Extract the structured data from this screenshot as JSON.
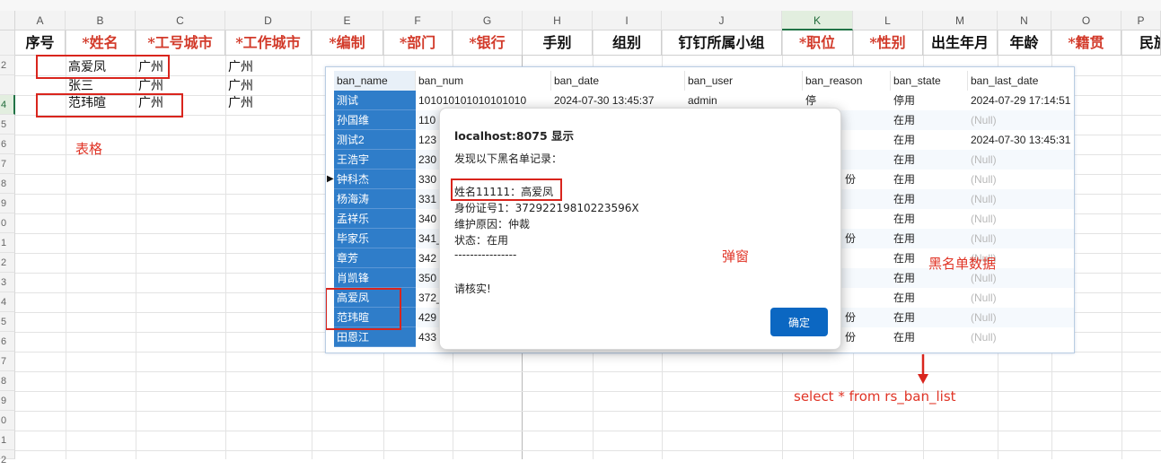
{
  "columns": [
    "A",
    "B",
    "C",
    "D",
    "E",
    "F",
    "G",
    "H",
    "I",
    "J",
    "K",
    "L",
    "M",
    "N",
    "O",
    "P"
  ],
  "rows": [
    "",
    "2",
    "",
    "4",
    "5",
    "6",
    "7",
    "8",
    "9",
    "0",
    "1",
    "2",
    "3",
    "4",
    "5",
    "6",
    "7",
    "8",
    "9",
    "0",
    "1",
    "2",
    "3",
    "4",
    "5"
  ],
  "header_row": [
    "序号",
    "*姓名",
    "*工号城市",
    "*工作城市",
    "*编制",
    "*部门",
    "*银行",
    "手别",
    "组别",
    "钉钉所属小组",
    "*职位",
    "*性别",
    "出生年月",
    "年龄",
    "*籍贯",
    "民族"
  ],
  "data_rows": [
    [
      "",
      "高爱凤",
      "广州",
      "广州"
    ],
    [
      "",
      "张三",
      "广州",
      "广州"
    ],
    [
      "",
      "范玮暄",
      "广州",
      "广州"
    ]
  ],
  "annotations": {
    "table": "表格",
    "popup": "弹窗",
    "blacklist": "黑名单数据",
    "sql": "select * from rs_ban_list"
  },
  "grid": {
    "headers": [
      "ban_name",
      "ban_num",
      "ban_date",
      "ban_user",
      "ban_reason",
      "ban_state",
      "ban_last_date"
    ],
    "rows": [
      [
        "测试",
        "101010101010101010",
        "2024-07-30 13:45:37",
        "admin",
        "停",
        "停用",
        "2024-07-29 17:14:51"
      ],
      [
        "孙国维",
        "110",
        "",
        "",
        "",
        "在用",
        "(Null)"
      ],
      [
        "测试2",
        "123",
        "",
        "",
        "",
        "在用",
        "2024-07-30 13:45:31"
      ],
      [
        "王浩宇",
        "230",
        "",
        "",
        "",
        "在用",
        "(Null)"
      ],
      [
        "钟科杰",
        "330",
        "",
        "",
        "份",
        "在用",
        "(Null)"
      ],
      [
        "杨海涛",
        "331",
        "",
        "",
        "",
        "在用",
        "(Null)"
      ],
      [
        "孟祥乐",
        "340",
        "",
        "",
        "",
        "在用",
        "(Null)"
      ],
      [
        "毕家乐",
        "341_",
        "",
        "",
        "份",
        "在用",
        "(Null)"
      ],
      [
        "章芳",
        "342",
        "",
        "",
        "",
        "在用",
        "(Null)"
      ],
      [
        "肖凯锋",
        "350",
        "",
        "",
        "",
        "在用",
        "(Null)"
      ],
      [
        "高爱凤",
        "372_",
        "",
        "",
        "",
        "在用",
        "(Null)"
      ],
      [
        "范玮暄",
        "429",
        "",
        "",
        "份",
        "在用",
        "(Null)"
      ],
      [
        "田恩江",
        "433",
        "",
        "",
        "份",
        "在用",
        "(Null)"
      ]
    ]
  },
  "dialog": {
    "title": "localhost:8075 显示",
    "line1": "发现以下黑名单记录：",
    "line2": "姓名11111：高爱凤",
    "line3": "身份证号1：37292219810223596X",
    "line4": "维护原因：仲裁",
    "line5": "状态：在用",
    "line6": "----------------",
    "line7": "请核实!",
    "ok_label": "确定"
  },
  "colors": {
    "accent_red": "#d9251d",
    "grid_blue": "#2f7dc9",
    "ok_button": "#0b67c2",
    "excel_green": "#217346"
  }
}
